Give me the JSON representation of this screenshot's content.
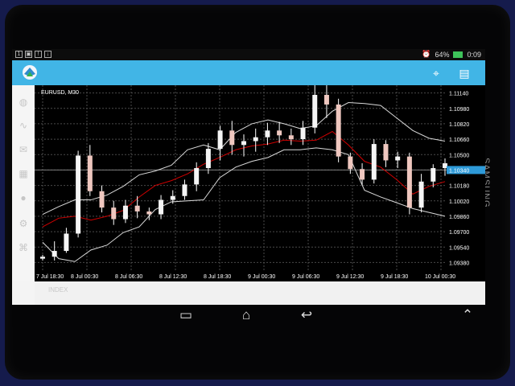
{
  "status_bar": {
    "battery": "64%",
    "time": "0:09"
  },
  "chart_header": {
    "symbol": "EURUSD, M30"
  },
  "chart_data": {
    "type": "candlestick",
    "x_labels": [
      "7 Jul 18:30",
      "8 Jul 00:30",
      "8 Jul 06:30",
      "8 Jul 12:30",
      "8 Jul 18:30",
      "9 Jul 00:30",
      "9 Jul 06:30",
      "9 Jul 12:30",
      "9 Jul 18:30",
      "10 Jul 00:30"
    ],
    "y_labels": [
      "1.11140",
      "1.10980",
      "1.10820",
      "1.10660",
      "1.10500",
      "1.10340",
      "1.10180",
      "1.10020",
      "1.09860",
      "1.09700",
      "1.09540",
      "1.09380"
    ],
    "current_price": "1.10340",
    "grid": true,
    "background": "#000000",
    "series": [
      {
        "name": "",
        "type": "line",
        "color": "#d9d9d9",
        "y": [
          1.0988,
          1.0996,
          1.1003,
          1.1003,
          1.1008,
          1.1017,
          1.1029,
          1.1033,
          1.1039,
          1.1055,
          1.106,
          1.1055,
          1.1073,
          1.1082,
          1.1086,
          1.1082,
          1.1077,
          1.108,
          1.1095,
          1.1104,
          1.1103,
          1.1101,
          1.1088,
          1.1075,
          1.1067,
          1.1064
        ]
      },
      {
        "name": "",
        "type": "line",
        "color": "#d9d9d9",
        "y": [
          1.0959,
          1.0942,
          1.0939,
          1.0951,
          1.0956,
          1.0969,
          1.0975,
          1.0993,
          1.1001,
          1.1002,
          1.1003,
          1.1026,
          1.1037,
          1.1043,
          1.1047,
          1.1055,
          1.1055,
          1.1057,
          1.1055,
          1.105,
          1.1013,
          1.1006,
          1.1,
          1.0994,
          1.099,
          1.0986
        ]
      },
      {
        "name": "",
        "type": "line",
        "color": "#d00000",
        "y": [
          1.0975,
          1.0984,
          1.0986,
          1.0982,
          1.0986,
          1.0992,
          1.1006,
          1.1018,
          1.1023,
          1.103,
          1.104,
          1.1047,
          1.1055,
          1.1059,
          1.1061,
          1.1065,
          1.1064,
          1.1065,
          1.1074,
          1.106,
          1.1043,
          1.1037,
          1.1024,
          1.1009,
          1.1017,
          1.1022
        ]
      }
    ],
    "candles": [
      {
        "o": 1.0942,
        "h": 1.0946,
        "l": 1.094,
        "c": 1.0944
      },
      {
        "o": 1.0944,
        "h": 1.096,
        "l": 1.094,
        "c": 1.095
      },
      {
        "o": 1.095,
        "h": 1.0974,
        "l": 1.0948,
        "c": 1.0968
      },
      {
        "o": 1.0968,
        "h": 1.1054,
        "l": 1.0964,
        "c": 1.1049
      },
      {
        "o": 1.1049,
        "h": 1.106,
        "l": 1.1007,
        "c": 1.1012
      },
      {
        "o": 1.1012,
        "h": 1.1018,
        "l": 1.099,
        "c": 1.0995
      },
      {
        "o": 1.0995,
        "h": 1.1002,
        "l": 1.0977,
        "c": 1.0983
      },
      {
        "o": 1.0983,
        "h": 1.1003,
        "l": 1.0979,
        "c": 1.0997
      },
      {
        "o": 1.0997,
        "h": 1.1007,
        "l": 1.0984,
        "c": 1.0991
      },
      {
        "o": 1.0991,
        "h": 1.0995,
        "l": 1.0982,
        "c": 1.0988
      },
      {
        "o": 1.0988,
        "h": 1.1008,
        "l": 1.0983,
        "c": 1.1003
      },
      {
        "o": 1.1003,
        "h": 1.1013,
        "l": 1.0999,
        "c": 1.1007
      },
      {
        "o": 1.1007,
        "h": 1.1024,
        "l": 1.1003,
        "c": 1.1019
      },
      {
        "o": 1.1019,
        "h": 1.1042,
        "l": 1.1012,
        "c": 1.1036
      },
      {
        "o": 1.1036,
        "h": 1.1062,
        "l": 1.103,
        "c": 1.1056
      },
      {
        "o": 1.1056,
        "h": 1.108,
        "l": 1.1044,
        "c": 1.1075
      },
      {
        "o": 1.1075,
        "h": 1.1085,
        "l": 1.105,
        "c": 1.106
      },
      {
        "o": 1.106,
        "h": 1.1071,
        "l": 1.1048,
        "c": 1.1064
      },
      {
        "o": 1.1064,
        "h": 1.1077,
        "l": 1.1053,
        "c": 1.1068
      },
      {
        "o": 1.1068,
        "h": 1.1083,
        "l": 1.106,
        "c": 1.1075
      },
      {
        "o": 1.1075,
        "h": 1.1084,
        "l": 1.1062,
        "c": 1.107
      },
      {
        "o": 1.107,
        "h": 1.1077,
        "l": 1.106,
        "c": 1.1066
      },
      {
        "o": 1.1066,
        "h": 1.1085,
        "l": 1.106,
        "c": 1.1078
      },
      {
        "o": 1.1078,
        "h": 1.1132,
        "l": 1.1072,
        "c": 1.1112
      },
      {
        "o": 1.1112,
        "h": 1.1122,
        "l": 1.1088,
        "c": 1.1102
      },
      {
        "o": 1.1102,
        "h": 1.1108,
        "l": 1.1042,
        "c": 1.1048
      },
      {
        "o": 1.1048,
        "h": 1.1052,
        "l": 1.103,
        "c": 1.1035
      },
      {
        "o": 1.1035,
        "h": 1.1041,
        "l": 1.1018,
        "c": 1.1024
      },
      {
        "o": 1.1024,
        "h": 1.1066,
        "l": 1.102,
        "c": 1.1061
      },
      {
        "o": 1.1061,
        "h": 1.1065,
        "l": 1.1037,
        "c": 1.1044
      },
      {
        "o": 1.1044,
        "h": 1.1053,
        "l": 1.1036,
        "c": 1.1048
      },
      {
        "o": 1.1048,
        "h": 1.1052,
        "l": 1.0988,
        "c": 1.0995
      },
      {
        "o": 1.0995,
        "h": 1.103,
        "l": 1.099,
        "c": 1.1022
      },
      {
        "o": 1.1022,
        "h": 1.104,
        "l": 1.1016,
        "c": 1.1036
      },
      {
        "o": 1.1036,
        "h": 1.1046,
        "l": 1.1028,
        "c": 1.1041
      }
    ]
  },
  "sidebar": {
    "items": [
      {
        "icon": "quotes-icon",
        "glyph": "◍"
      },
      {
        "icon": "chart-icon",
        "glyph": "∿"
      },
      {
        "icon": "mail-icon",
        "glyph": "✉"
      },
      {
        "icon": "history-icon",
        "glyph": "▦"
      },
      {
        "icon": "chat-icon",
        "glyph": "●"
      },
      {
        "icon": "settings-icon",
        "glyph": "⚙"
      },
      {
        "icon": "community-icon",
        "glyph": "⌘"
      }
    ]
  },
  "bottom_tab": "INDEX",
  "toolbar": {
    "left_icon": "app-logo-icon",
    "right_icons": [
      "crosshair-icon",
      "document-icon"
    ]
  },
  "nav": {
    "buttons": [
      "recent-apps-icon",
      "home-icon",
      "back-icon",
      "expand-icon"
    ]
  },
  "device_brand": "SAMSUNG"
}
